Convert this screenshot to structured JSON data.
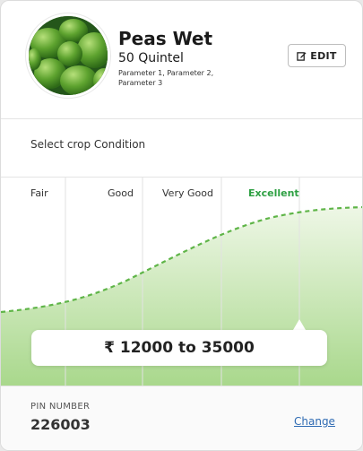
{
  "product": {
    "name": "Peas Wet",
    "quantity": "50 Quintel",
    "parameters": "Parameter 1, Parameter 2, Parameter 3",
    "image_icon": "peas-image"
  },
  "edit_button": {
    "label": "EDIT",
    "icon": "edit-icon"
  },
  "condition": {
    "prompt": "Select crop Condition",
    "options": [
      "Fair",
      "Good",
      "Very Good",
      "Excellent"
    ],
    "selected": "Excellent",
    "price_range": "₹ 12000 to 35000"
  },
  "location": {
    "pin_label": "PIN NUMBER",
    "pin_value": "226003",
    "change_label": "Change"
  },
  "colors": {
    "accent_green": "#2ea043",
    "curve_green": "#5fb548",
    "fill_green": "#b7df9e",
    "link_blue": "#2f6bb3"
  }
}
